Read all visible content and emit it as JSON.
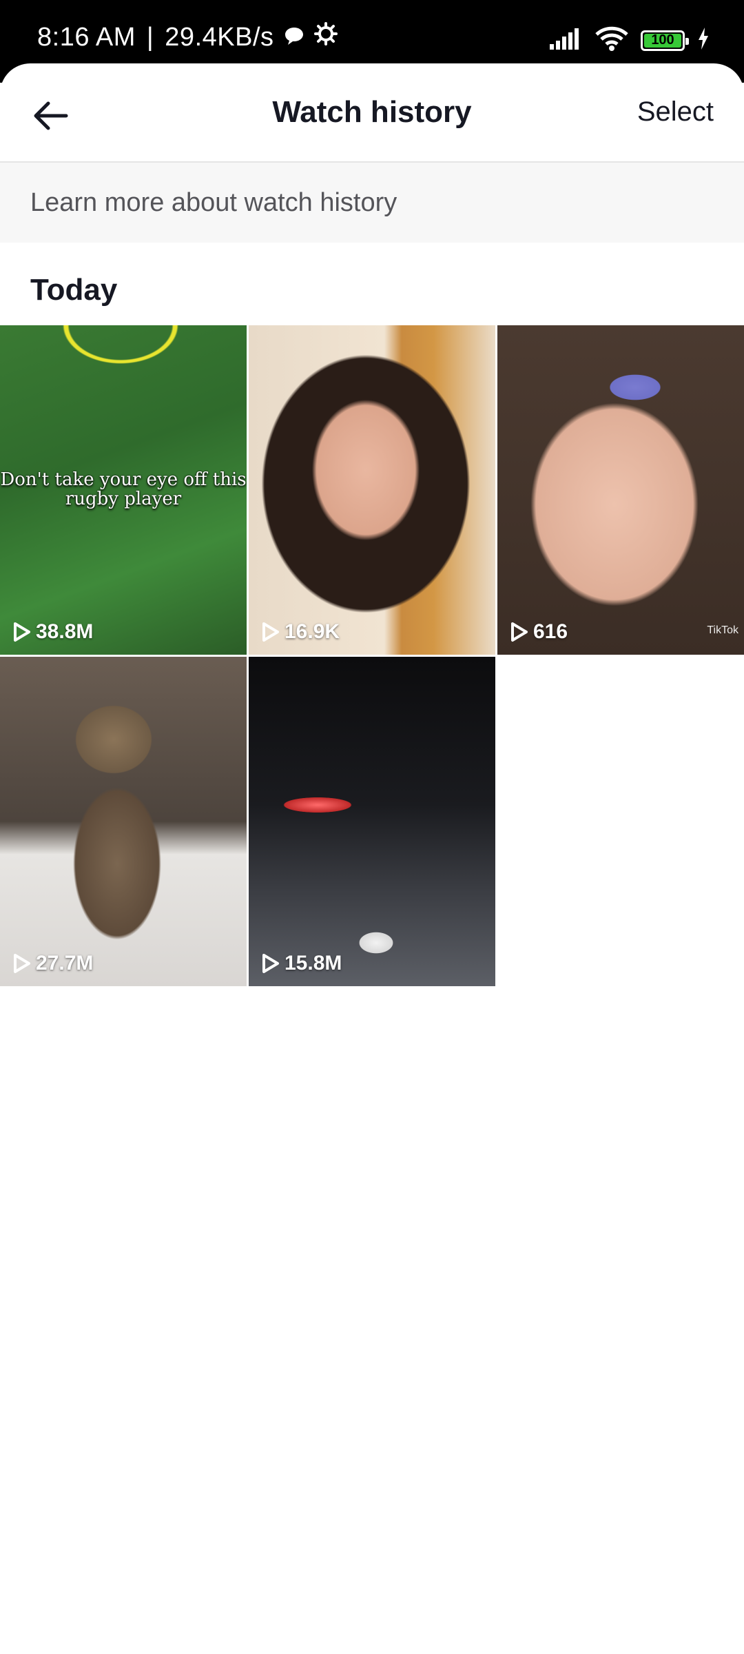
{
  "status_bar": {
    "time": "8:16 AM",
    "separator": "|",
    "speed": "29.4KB/s",
    "battery": "100",
    "icons": [
      "chat-bubble-icon",
      "gear-icon",
      "signal-icon",
      "wifi-icon",
      "battery-icon",
      "charging-icon"
    ]
  },
  "header": {
    "title": "Watch history",
    "select_label": "Select",
    "back_icon": "arrow-left-icon"
  },
  "banner": {
    "text": "Learn more about watch history"
  },
  "section": {
    "title": "Today"
  },
  "videos": [
    {
      "views": "38.8M",
      "caption": "Don't take your eye off this rugby player"
    },
    {
      "views": "16.9K"
    },
    {
      "views": "616",
      "watermark": "TikTok"
    },
    {
      "views": "27.7M"
    },
    {
      "views": "15.8M"
    }
  ],
  "colors": {
    "text_primary": "#161823",
    "text_secondary": "#545459",
    "banner_bg": "#f7f7f7",
    "battery_green": "#37c937"
  }
}
